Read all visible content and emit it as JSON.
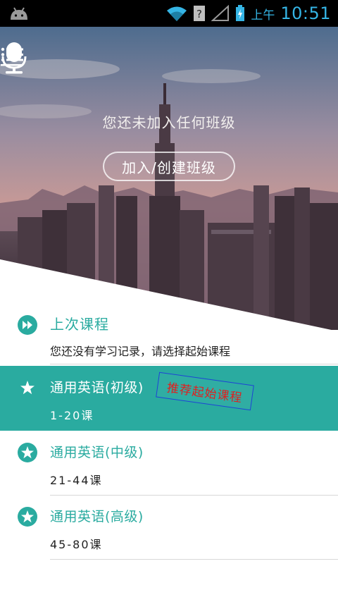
{
  "status_bar": {
    "ampm": "上午",
    "time": "10:51",
    "icons": [
      "android-icon",
      "wifi-icon",
      "unknown-sim-icon",
      "signal-icon",
      "battery-charging-icon"
    ]
  },
  "hero": {
    "message": "您还未加入任何班级",
    "join_button": "加入/创建班级",
    "icons": [
      "menu-icon",
      "microphone-icon"
    ]
  },
  "last_course": {
    "title": "上次课程",
    "subtitle": "您还没有学习记录，请选择起始课程",
    "icon": "fast-forward-icon"
  },
  "courses": [
    {
      "title": "通用英语(初级)",
      "range": "1-20课",
      "selected": true,
      "stamp": "推荐起始课程",
      "icon": "star-icon"
    },
    {
      "title": "通用英语(中级)",
      "range": "21-44课",
      "selected": false,
      "icon": "star-icon"
    },
    {
      "title": "通用英语(高级)",
      "range": "45-80课",
      "selected": false,
      "icon": "star-icon"
    }
  ],
  "colors": {
    "accent": "#2aaba0",
    "status_text": "#35b5e5",
    "stamp_text": "#e02020",
    "stamp_border": "#1d43d6"
  }
}
